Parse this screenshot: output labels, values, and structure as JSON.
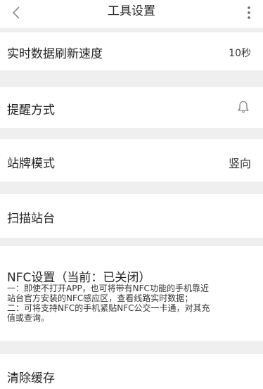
{
  "header": {
    "title": "工具设置",
    "back_icon": "chevron-left-icon",
    "more_icon": "more-vertical-icon"
  },
  "settings": {
    "refresh_speed": {
      "label": "实时数据刷新速度",
      "value": "10秒"
    },
    "reminder": {
      "label": "提醒方式",
      "icon": "bell-icon"
    },
    "station_mode": {
      "label": "站牌模式",
      "value": "竖向"
    },
    "scan_station": {
      "label": "扫描站台"
    },
    "nfc": {
      "title": "NFC设置（当前：已关闭）",
      "desc_lines": [
        "一：即使不打开APP，也可将带有NFC功能的手机靠近",
        "站台官方安装的NFC感应区，查看线路实时数据；",
        "二：可将支持NFC的手机紧贴NFC公交一卡通，对其充",
        "值或查询。"
      ]
    },
    "clear_cache": {
      "label": "清除缓存"
    }
  },
  "colors": {
    "background": "#efefef",
    "card": "#ffffff",
    "text": "#222222"
  }
}
